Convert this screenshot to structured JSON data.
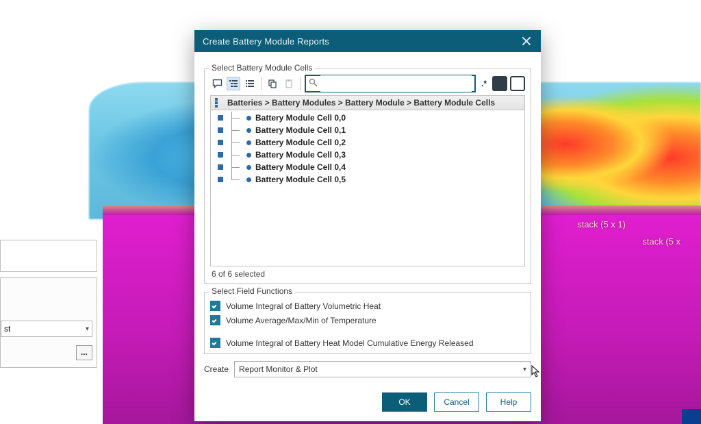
{
  "bg": {
    "stack1": "stack (5 x 1)",
    "stack2": "stack (5 x"
  },
  "side": {
    "combo_value": "st",
    "dots": "..."
  },
  "dialog": {
    "title": "Create Battery Module Reports",
    "group_cells": {
      "legend": "Select Battery Module Cells",
      "search_value": "",
      "dot_star": ".*",
      "breadcrumb": "Batteries > Battery Modules > Battery Module > Battery Module Cells",
      "items": [
        "Battery Module Cell 0,0",
        "Battery Module Cell 0,1",
        "Battery Module Cell 0,2",
        "Battery Module Cell 0,3",
        "Battery Module Cell 0,4",
        "Battery Module Cell 0,5"
      ],
      "status": "6 of 6 selected"
    },
    "group_funcs": {
      "legend": "Select Field Functions",
      "opts": [
        "Volume Integral of Battery Volumetric Heat",
        "Volume Average/Max/Min of Temperature",
        "Volume Integral of Battery Heat Model Cumulative Energy Released"
      ]
    },
    "create_label": "Create",
    "create_value": "Report Monitor & Plot",
    "buttons": {
      "ok": "OK",
      "cancel": "Cancel",
      "help": "Help"
    }
  }
}
